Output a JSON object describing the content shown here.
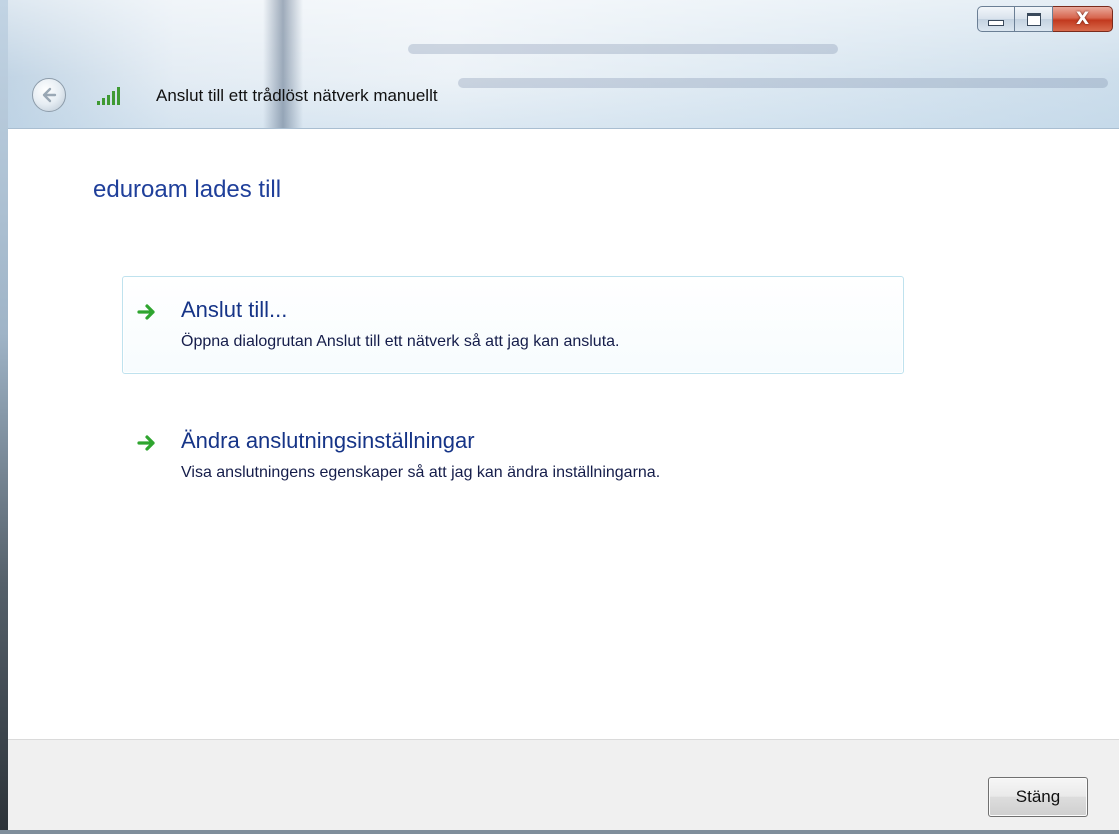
{
  "window": {
    "title": "Anslut till ett trådlöst nätverk manuellt",
    "caption_buttons": {
      "minimize_icon": "minimize-icon",
      "maximize_icon": "maximize-icon",
      "close_glyph": "X"
    },
    "back_icon": "back-arrow-icon",
    "network_icon": "wireless-signal-icon"
  },
  "main": {
    "heading": "eduroam lades till",
    "links": [
      {
        "title": "Anslut till...",
        "description": "Öppna dialogrutan Anslut till ett nätverk så att jag kan ansluta.",
        "icon": "green-arrow-icon"
      },
      {
        "title": "Ändra anslutningsinställningar",
        "description": "Visa anslutningens egenskaper så att jag kan ändra inställningarna.",
        "icon": "green-arrow-icon"
      }
    ]
  },
  "footer": {
    "close_label": "Stäng"
  },
  "colors": {
    "heading": "#1f3f9a",
    "link_title": "#163487",
    "arrow": "#2fa52f",
    "close_button_red": "#c2391e"
  }
}
